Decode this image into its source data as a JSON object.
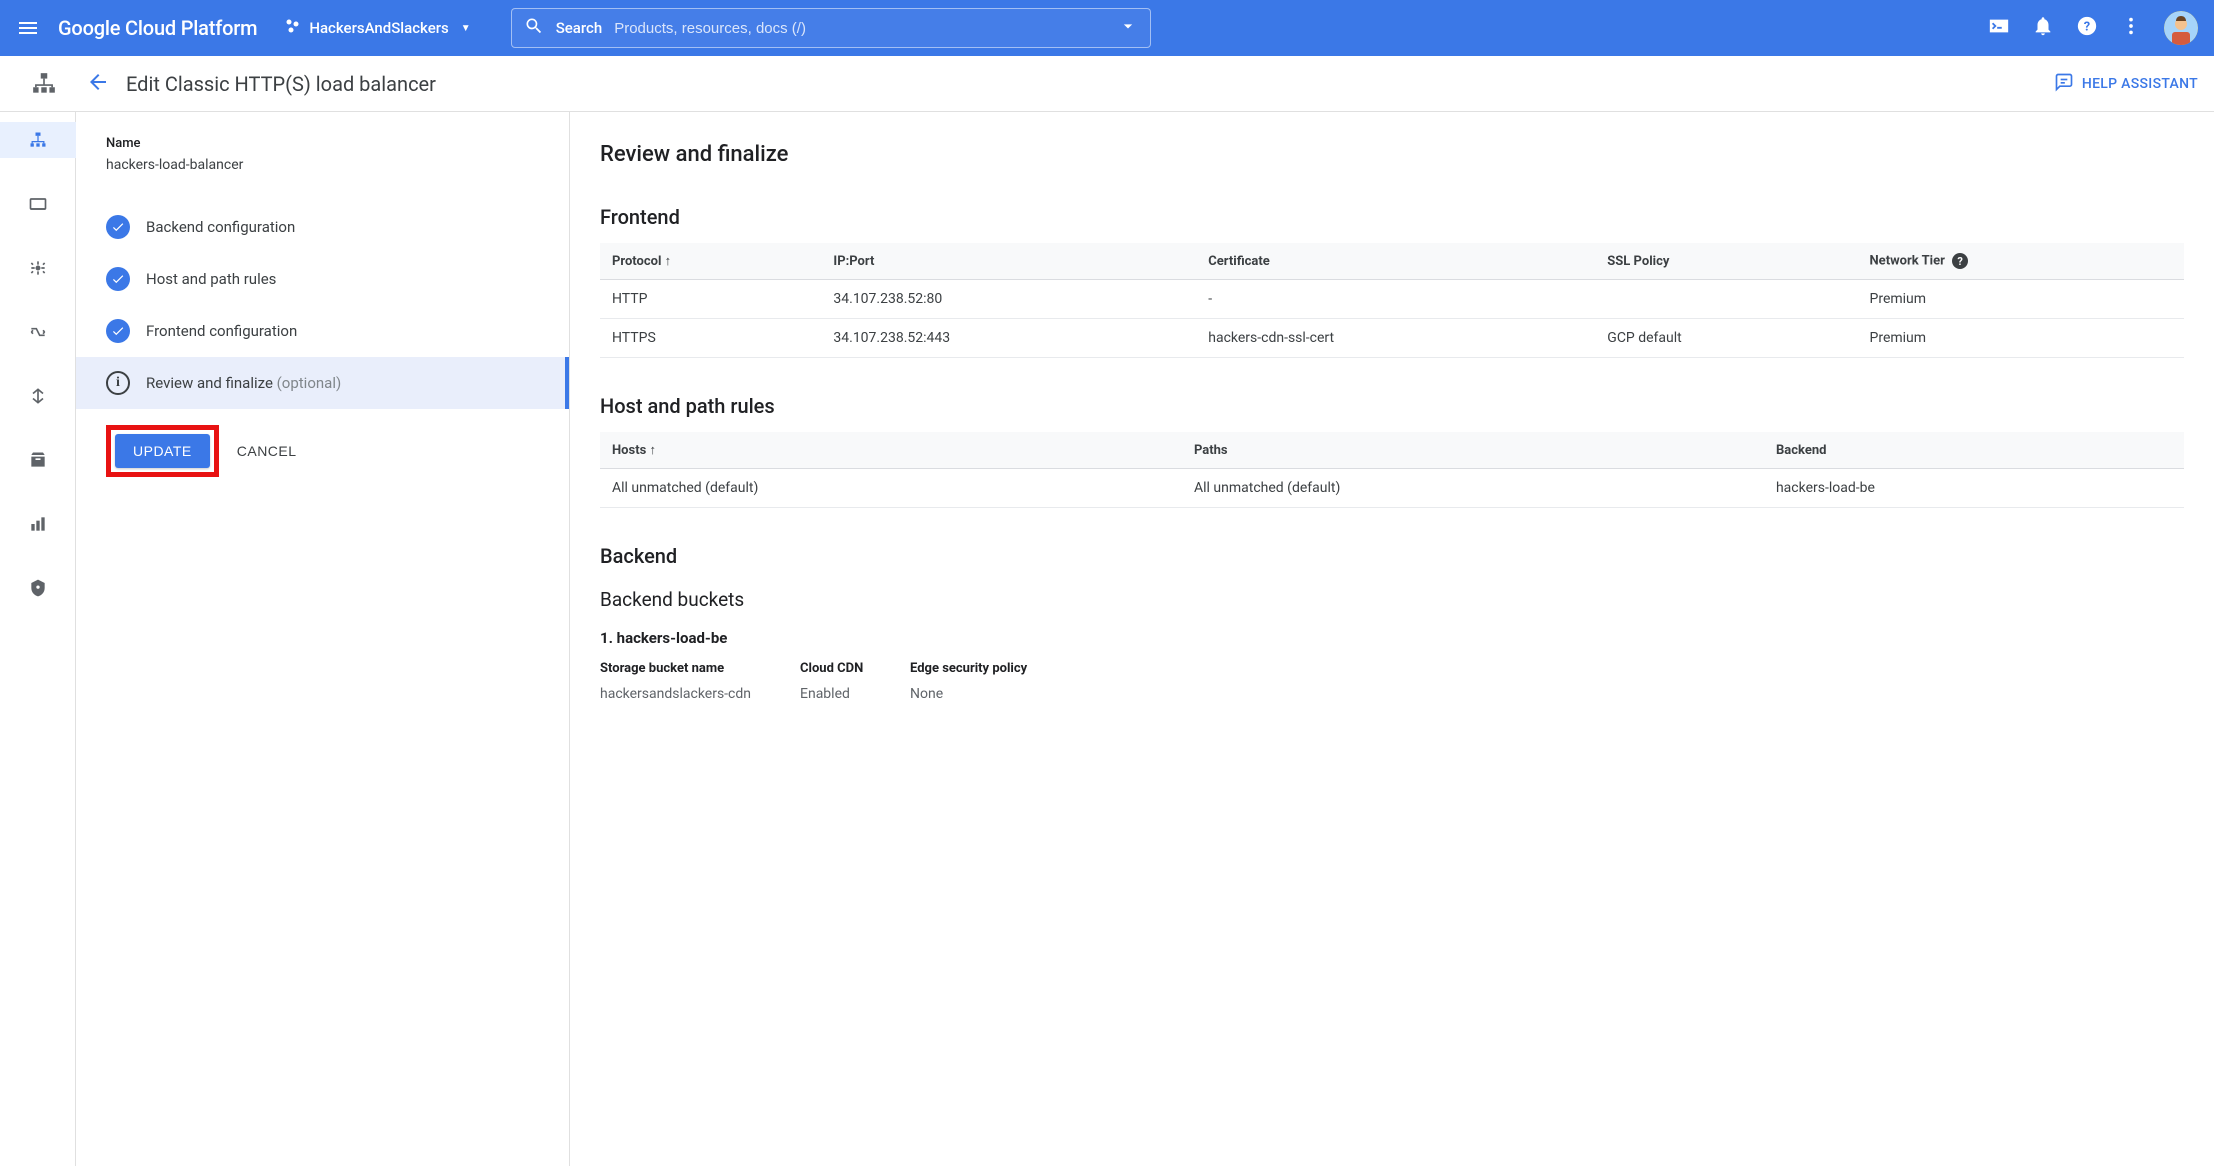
{
  "header": {
    "logo": "Google Cloud Platform",
    "project_name": "HackersAndSlackers",
    "search_label": "Search",
    "search_placeholder": "Products, resources, docs (/)"
  },
  "subheader": {
    "page_title": "Edit Classic HTTP(S) load balancer",
    "help_assistant": "HELP ASSISTANT"
  },
  "left": {
    "name_label": "Name",
    "name_value": "hackers-load-balancer",
    "steps": [
      {
        "label": "Backend configuration",
        "complete": true
      },
      {
        "label": "Host and path rules",
        "complete": true
      },
      {
        "label": "Frontend configuration",
        "complete": true
      },
      {
        "label": "Review and finalize",
        "optional": "(optional)",
        "active": true
      }
    ],
    "update_button": "UPDATE",
    "cancel_button": "CANCEL"
  },
  "review": {
    "title": "Review and finalize",
    "frontend": {
      "heading": "Frontend",
      "columns": [
        "Protocol",
        "IP:Port",
        "Certificate",
        "SSL Policy",
        "Network Tier"
      ],
      "rows": [
        {
          "protocol": "HTTP",
          "ipport": "34.107.238.52:80",
          "cert": "-",
          "ssl": "",
          "tier": "Premium"
        },
        {
          "protocol": "HTTPS",
          "ipport": "34.107.238.52:443",
          "cert": "hackers-cdn-ssl-cert",
          "ssl": "GCP default",
          "tier": "Premium"
        }
      ]
    },
    "hostpath": {
      "heading": "Host and path rules",
      "columns": [
        "Hosts",
        "Paths",
        "Backend"
      ],
      "rows": [
        {
          "hosts": "All unmatched (default)",
          "paths": "All unmatched (default)",
          "backend": "hackers-load-be"
        }
      ]
    },
    "backend": {
      "heading": "Backend",
      "buckets_heading": "Backend buckets",
      "bucket_title": "1. hackers-load-be",
      "grid_headers": [
        "Storage bucket name",
        "Cloud CDN",
        "Edge security policy"
      ],
      "grid_values": [
        "hackersandslackers-cdn",
        "Enabled",
        "None"
      ]
    }
  }
}
